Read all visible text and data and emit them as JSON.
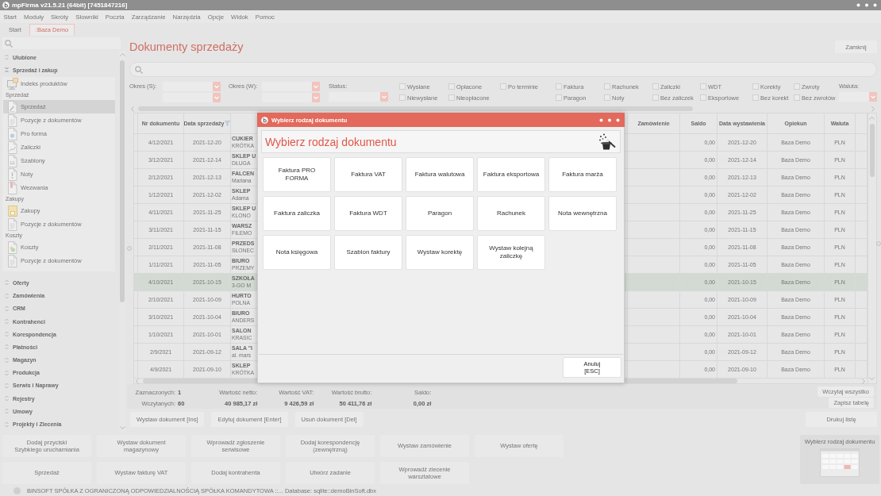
{
  "window": {
    "title": "mpFirma v21.5.21 (64bit) [7451847216]"
  },
  "menu": [
    "Start",
    "Moduły",
    "Skróty",
    "Słowniki",
    "Poczta",
    "Zarządzanie",
    "Narzędzia",
    "Opcje",
    "Widok",
    "Pomoc"
  ],
  "tabs": [
    {
      "label": "Start",
      "selected": false
    },
    {
      "label": ":Baza Demo",
      "selected": true
    }
  ],
  "sidebar": {
    "sections": [
      {
        "label": "Ulubione",
        "expanded": false
      },
      {
        "label": "Sprzedaż i zakup",
        "expanded": true,
        "children": [
          {
            "kind": "item",
            "label": "Indeks produktów",
            "selected": false
          },
          {
            "kind": "group",
            "label": "Sprzedaż"
          },
          {
            "kind": "item",
            "label": "Sprzedaż",
            "selected": true
          },
          {
            "kind": "item",
            "label": "Pozycje z dokumentów",
            "selected": false
          },
          {
            "kind": "item",
            "label": "Pro forma",
            "selected": false
          },
          {
            "kind": "item",
            "label": "Zaliczki",
            "selected": false
          },
          {
            "kind": "item",
            "label": "Szablony",
            "selected": false
          },
          {
            "kind": "item",
            "label": "Noty",
            "selected": false
          },
          {
            "kind": "item",
            "label": "Wezwania",
            "selected": false
          },
          {
            "kind": "group",
            "label": "Zakupy"
          },
          {
            "kind": "item",
            "label": "Zakupy",
            "selected": false
          },
          {
            "kind": "item",
            "label": "Pozycje z dokumentów",
            "selected": false
          },
          {
            "kind": "group",
            "label": "Koszty"
          },
          {
            "kind": "item",
            "label": "Koszty",
            "selected": false
          },
          {
            "kind": "item",
            "label": "Pozycje z dokumentów",
            "selected": false
          }
        ]
      },
      {
        "label": "Oferty",
        "expanded": false
      },
      {
        "label": "Zamówienia",
        "expanded": false
      },
      {
        "label": "CRM",
        "expanded": false
      },
      {
        "label": "Kontrahenci",
        "expanded": false
      },
      {
        "label": "Korespondencja",
        "expanded": false
      },
      {
        "label": "Płatności",
        "expanded": false
      },
      {
        "label": "Magazyn",
        "expanded": false
      },
      {
        "label": "Produkcja",
        "expanded": false
      },
      {
        "label": "Serwis i Naprawy",
        "expanded": false
      },
      {
        "label": "Rejestry",
        "expanded": false
      },
      {
        "label": "Umowy",
        "expanded": false
      },
      {
        "label": "Projekty i Zlecenia",
        "expanded": false
      }
    ]
  },
  "page": {
    "title": "Dokumenty sprzedaży",
    "close_button": "Zamknij"
  },
  "filters": {
    "sale_period_label": "Okres (S):",
    "issue_period_label": "Okres (W):",
    "status_label": "Status:",
    "checkbox_columns": [
      [
        {
          "label": "Wysłane",
          "checked": false
        },
        {
          "label": "Niewysłane",
          "checked": false
        }
      ],
      [
        {
          "label": "Opłacone",
          "checked": false
        },
        {
          "label": "Nieopłacone",
          "checked": false
        }
      ],
      [
        {
          "label": "Po terminie",
          "checked": false
        }
      ],
      [
        {
          "label": "Faktura",
          "checked": false
        },
        {
          "label": "Paragon",
          "checked": false
        }
      ],
      [
        {
          "label": "Rachunek",
          "checked": false
        },
        {
          "label": "Noty",
          "checked": false
        }
      ],
      [
        {
          "label": "Zaliczki",
          "checked": false
        },
        {
          "label": "Bez zaliczek",
          "checked": false
        }
      ],
      [
        {
          "label": "WDT",
          "checked": false
        },
        {
          "label": "Eksportowe",
          "checked": false
        }
      ],
      [
        {
          "label": "Korekty",
          "checked": false
        },
        {
          "label": "Bez korekt",
          "checked": false
        }
      ],
      [
        {
          "label": "Zwroty",
          "checked": false
        },
        {
          "label": "Bez zwrotów",
          "checked": false
        }
      ]
    ],
    "currency_label": "Waluta:"
  },
  "table": {
    "columns": [
      {
        "label": "Nr dokumentu",
        "filtered": false
      },
      {
        "label": "Data sprzedaży",
        "filtered": true
      },
      {
        "label": "Zamówienie",
        "filtered": false
      },
      {
        "label": "Saldo",
        "filtered": false
      },
      {
        "label": "Data wystawienia",
        "filtered": false
      },
      {
        "label": "Opiekun",
        "filtered": false
      },
      {
        "label": "Waluta",
        "filtered": false
      }
    ],
    "rows": [
      {
        "number": "4/12/2021",
        "sale_date": "2021-12-20",
        "column_3": [
          "CUKIER",
          "KRÓTKA"
        ],
        "balance": "0,00",
        "issue_date": "2021-12-20",
        "keeper": "Baza Demo",
        "currency": "PLN",
        "selected": false
      },
      {
        "number": "3/12/2021",
        "sale_date": "2021-12-14",
        "column_3": [
          "SKLEP U",
          "DŁUGA"
        ],
        "balance": "0,00",
        "issue_date": "2021-12-14",
        "keeper": "Baza Demo",
        "currency": "PLN",
        "selected": false
      },
      {
        "number": "2/12/2021",
        "sale_date": "2021-12-13",
        "column_3": [
          "FALCEN",
          "Mariana"
        ],
        "balance": "0,00",
        "issue_date": "2021-12-13",
        "keeper": "Baza Demo",
        "currency": "PLN",
        "selected": false
      },
      {
        "number": "1/12/2021",
        "sale_date": "2021-12-02",
        "column_3": [
          "SKLEP",
          "Adama"
        ],
        "balance": "0,00",
        "issue_date": "2021-12-02",
        "keeper": "Baza Demo",
        "currency": "PLN",
        "selected": false
      },
      {
        "number": "4/11/2021",
        "sale_date": "2021-11-25",
        "column_3": [
          "SKLEP U",
          "KLONO"
        ],
        "balance": "0,00",
        "issue_date": "2021-11-25",
        "keeper": "Baza Demo",
        "currency": "PLN",
        "selected": false
      },
      {
        "number": "3/11/2021",
        "sale_date": "2021-11-15",
        "column_3": [
          "WARSZ",
          "FILEMO"
        ],
        "balance": "0,00",
        "issue_date": "2021-11-15",
        "keeper": "Baza Demo",
        "currency": "PLN",
        "selected": false
      },
      {
        "number": "2/11/2021",
        "sale_date": "2021-11-08",
        "column_3": [
          "PRZEDS",
          "SŁONEC"
        ],
        "balance": "0,00",
        "issue_date": "2021-11-08",
        "keeper": "Baza Demo",
        "currency": "PLN",
        "selected": false
      },
      {
        "number": "1/11/2021",
        "sale_date": "2021-11-05",
        "column_3": [
          "BIURO",
          "PRZEMY"
        ],
        "balance": "0,00",
        "issue_date": "2021-11-05",
        "keeper": "Baza Demo",
        "currency": "PLN",
        "selected": false
      },
      {
        "number": "4/10/2021",
        "sale_date": "2021-10-15",
        "column_3": [
          "SZKOŁA",
          "3-GO M"
        ],
        "balance": "0,00",
        "issue_date": "2021-10-15",
        "keeper": "Baza Demo",
        "currency": "PLN",
        "selected": true
      },
      {
        "number": "2/10/2021",
        "sale_date": "2021-10-09",
        "column_3": [
          "HURTO",
          "POLNA"
        ],
        "balance": "0,00",
        "issue_date": "2021-10-09",
        "keeper": "Baza Demo",
        "currency": "PLN",
        "selected": false
      },
      {
        "number": "3/10/2021",
        "sale_date": "2021-10-04",
        "column_3": [
          "BIURO",
          "ANDERS"
        ],
        "balance": "0,00",
        "issue_date": "2021-10-04",
        "keeper": "Baza Demo",
        "currency": "PLN",
        "selected": false
      },
      {
        "number": "1/10/2021",
        "sale_date": "2021-10-01",
        "column_3": [
          "SALON",
          "KRASIC"
        ],
        "balance": "0,00",
        "issue_date": "2021-10-01",
        "keeper": "Baza Demo",
        "currency": "PLN",
        "selected": false
      },
      {
        "number": "2/9/2021",
        "sale_date": "2021-09-12",
        "column_3": [
          "SALA \"I",
          "al. mars"
        ],
        "balance": "0,00",
        "issue_date": "2021-09-12",
        "keeper": "Baza Demo",
        "currency": "PLN",
        "selected": false
      },
      {
        "number": "4/9/2021",
        "sale_date": "2021-09-10",
        "column_3": [
          "SKLEP",
          "KRÓTKA"
        ],
        "balance": "0,00",
        "issue_date": "2021-09-10",
        "keeper": "Baza Demo",
        "currency": "PLN",
        "selected": false
      }
    ]
  },
  "summary": {
    "counts": [
      {
        "label": "Zaznaczonych:",
        "value": "1"
      },
      {
        "label": "Wczytanych:",
        "value": "60"
      }
    ],
    "totals": [
      {
        "label": "Wartość netto:",
        "value": "40 985,17 zł"
      },
      {
        "label": "Wartość VAT:",
        "value": "9 426,59 zł"
      },
      {
        "label": "Wartość brutto:",
        "value": "50 411,76 zł"
      },
      {
        "label": "Saldo:",
        "value": "0,00 zł"
      }
    ],
    "buttons": [
      "Wczytaj wszystko",
      "Zapisz tabelę"
    ]
  },
  "actions": {
    "buttons": [
      "Wystaw dokument [Ins]",
      "Edytuj dokument [Enter]",
      "Usuń dokument [Del]"
    ],
    "print_button": "Drukuj listę"
  },
  "quick_launch": {
    "rows": [
      [
        "Dodaj przyciski\nSzybkiego uruchamiania",
        "Wystaw dokument\nmagazynowy",
        "Wprowadź zgłoszenie\nserwisowe",
        "Dodaj korespondencję\n(zewnętrzną)",
        "Wystaw zamówienie",
        "Wystaw ofertę"
      ],
      [
        "Sprzedaż",
        "Wystaw fakturę VAT",
        "Dodaj kontrahenta",
        "Utwórz zadanie",
        "Wprowadź zlecenie\nwarsztatowe"
      ]
    ],
    "preview_label": "Wybierz rodzaj dokumentu"
  },
  "status_bar": {
    "text": "BINSOFT SPÓŁKA Z OGRANICZONĄ ODPOWIEDZIALNOŚCIĄ SPÓŁKA KOMANDYTOWA ::... Database: sqlite::demoBinSoft.dbx"
  },
  "dialog": {
    "title": "Wybierz rodzaj dokumentu",
    "heading": "Wybierz rodzaj dokumentu",
    "options": [
      "Faktura PRO FORMA",
      "Faktura VAT",
      "Faktura walutowa",
      "Faktura eksportowa",
      "Faktura marża",
      "Faktura zaliczka",
      "Faktura WDT",
      "Paragon",
      "Rachunek",
      "Nota wewnętrzna",
      "Nota księgowa",
      "Szablon faktury",
      "Wystaw korektę",
      "Wystaw kolejną zaliczkę"
    ],
    "cancel_button": "Anuluj\n[ESC]"
  }
}
